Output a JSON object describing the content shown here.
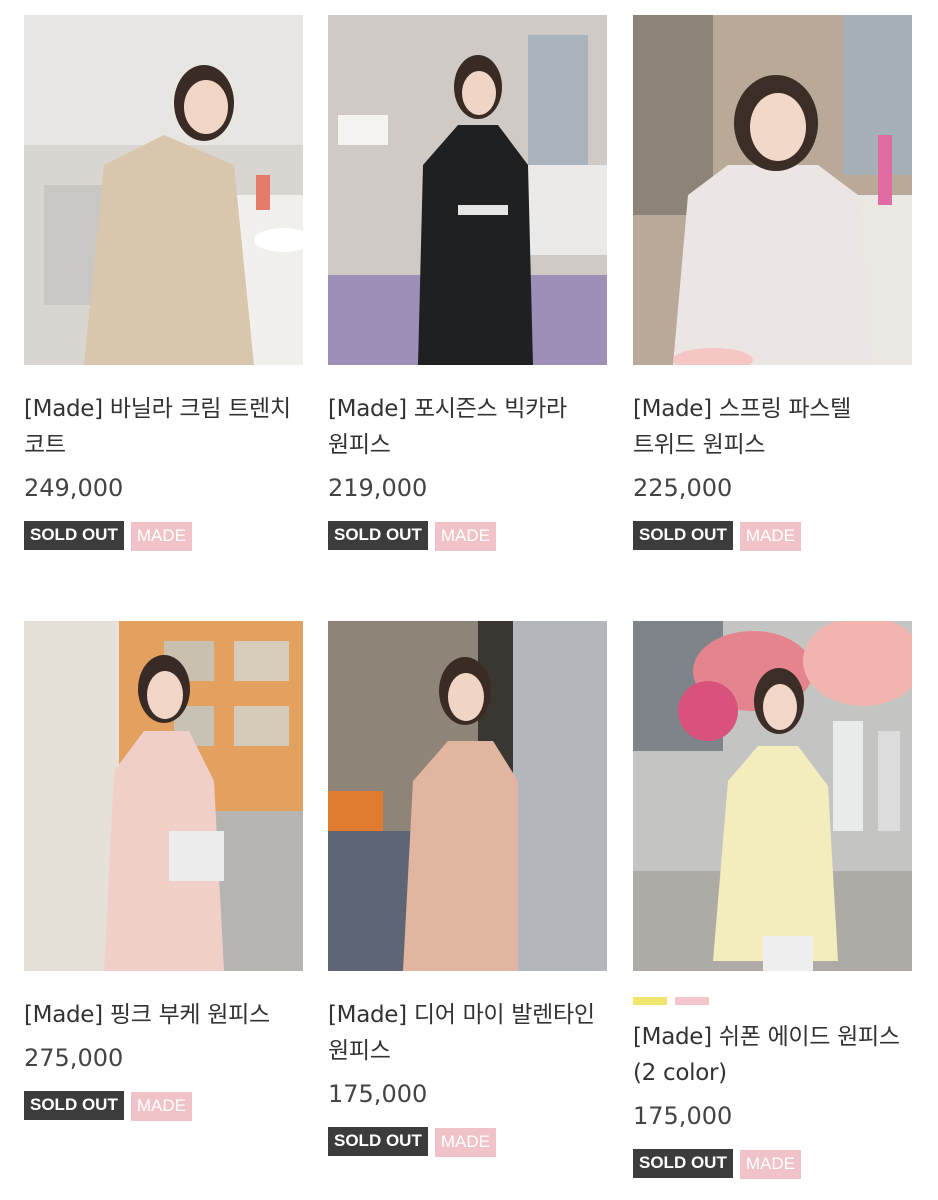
{
  "colors": {
    "sold_out_bg": "#3c3c3c",
    "made_bg": "#f0c3c8",
    "text": "#333333"
  },
  "products": [
    {
      "title": "[Made] 바닐라 크림 트렌치 코트",
      "price": "249,000",
      "badges": [
        "SOLD OUT",
        "MADE"
      ],
      "image": "woman-beige-trench-coat-photo"
    },
    {
      "title": "[Made] 포시즌스 빅카라 원피스",
      "price": "219,000",
      "badges": [
        "SOLD OUT",
        "MADE"
      ],
      "image": "woman-black-dress-photo"
    },
    {
      "title": "[Made] 스프링 파스텔 트위드 원피스",
      "price": "225,000",
      "badges": [
        "SOLD OUT",
        "MADE"
      ],
      "image": "woman-tweed-dress-photo"
    },
    {
      "title": "[Made] 핑크 부케 원피스",
      "price": "275,000",
      "badges": [
        "SOLD OUT",
        "MADE"
      ],
      "image": "woman-pink-dress-photo"
    },
    {
      "title": "[Made] 디어 마이 발렌타인 원피스",
      "price": "175,000",
      "badges": [
        "SOLD OUT",
        "MADE"
      ],
      "image": "woman-beige-pleated-dress-photo"
    },
    {
      "title": "[Made] 쉬폰 에이드 원피스 (2 color)",
      "price": "175,000",
      "badges": [
        "SOLD OUT",
        "MADE"
      ],
      "image": "woman-yellow-chiffon-dress-photo",
      "swatches": [
        "#f2e56e",
        "#f3c6cc"
      ]
    }
  ]
}
